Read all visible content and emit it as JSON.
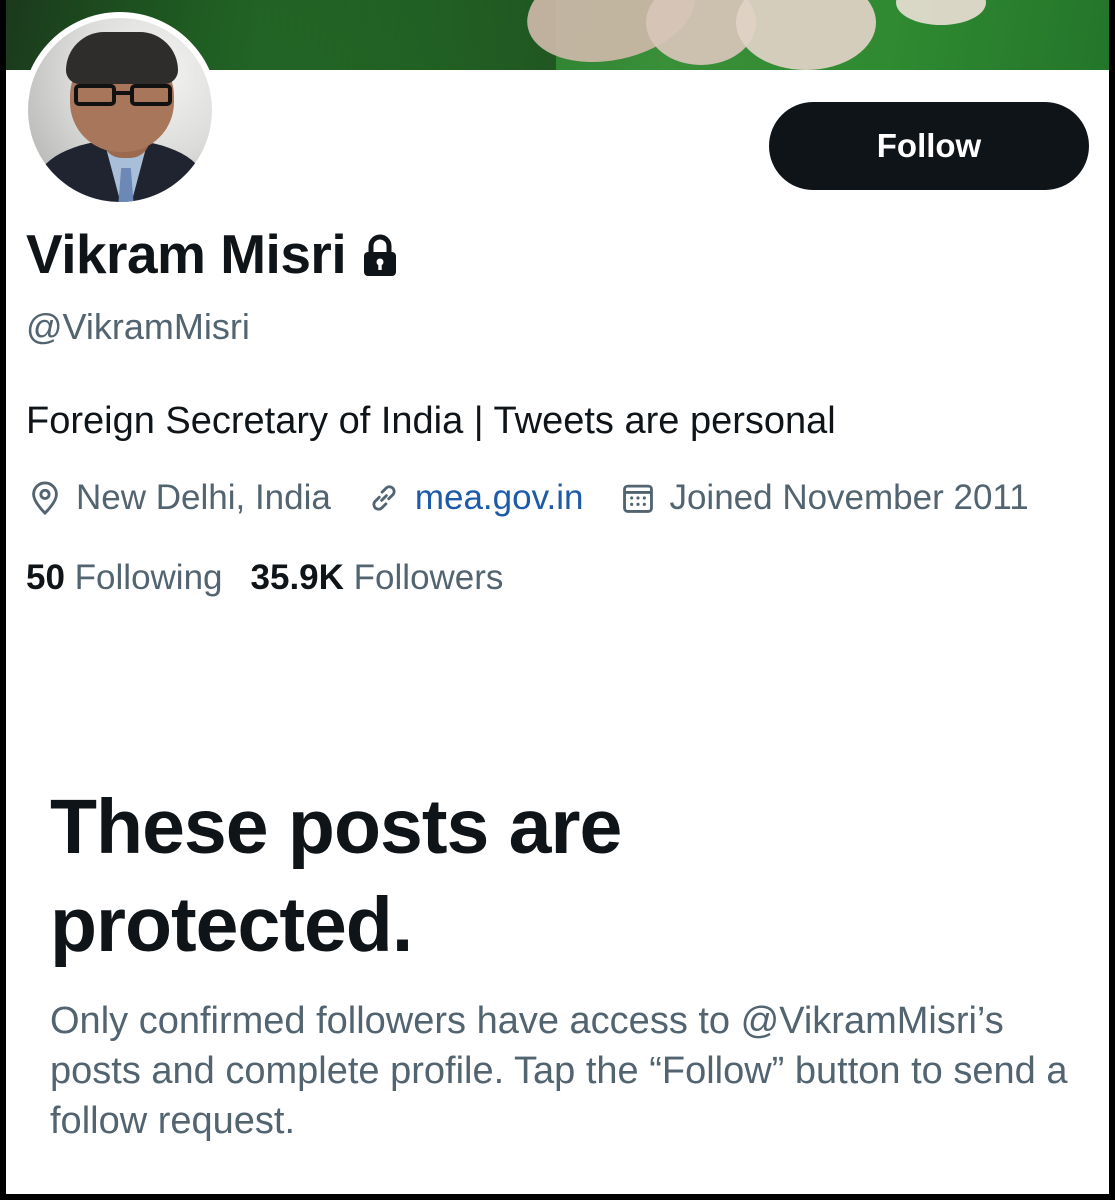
{
  "banner": {
    "description_icon": "banner-image"
  },
  "profile": {
    "name": "Vikram Misri",
    "handle": "@VikramMisri",
    "bio": "Foreign Secretary of India | Tweets are personal",
    "location": "New Delhi, India",
    "website": "mea.gov.in",
    "joined": "Joined November 2011",
    "following_count": "50",
    "following_label": "Following",
    "followers_count": "35.9K",
    "followers_label": "Followers",
    "protected": true
  },
  "actions": {
    "follow_label": "Follow"
  },
  "protected_notice": {
    "title": "These posts are protected.",
    "description": "Only confirmed followers have access to @VikramMisri’s posts and complete profile. Tap the “Follow” button to send a follow request."
  },
  "colors": {
    "button_bg": "#0f1419",
    "primary_text": "#0f1419",
    "secondary_text": "#536471",
    "link": "#1d5ba8"
  },
  "icons": [
    "lock-icon",
    "location-pin-icon",
    "link-icon",
    "calendar-icon"
  ]
}
